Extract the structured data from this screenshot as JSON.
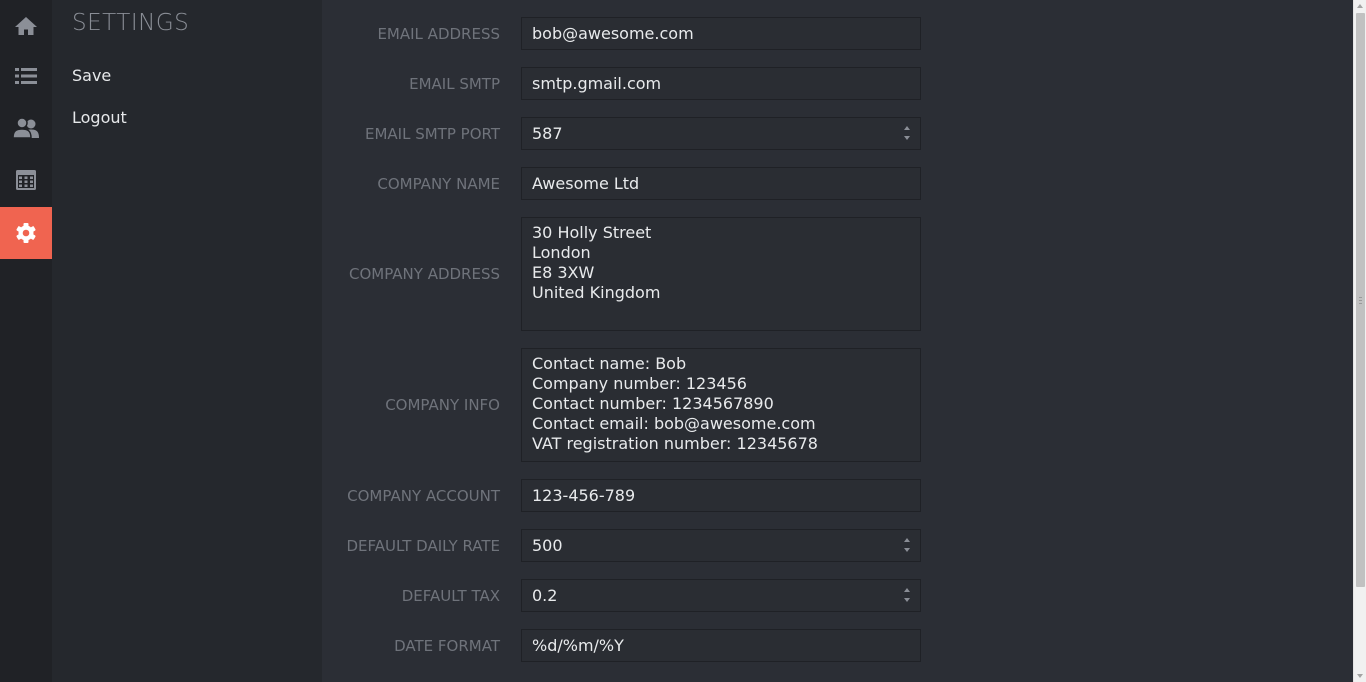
{
  "rail": {
    "items": [
      {
        "icon": "home-icon",
        "active": false
      },
      {
        "icon": "list-icon",
        "active": false
      },
      {
        "icon": "users-icon",
        "active": false
      },
      {
        "icon": "calendar-icon",
        "active": false
      },
      {
        "icon": "gear-icon",
        "active": true
      }
    ],
    "active_color": "#f06450"
  },
  "sidebar": {
    "title": "SETTINGS",
    "links": [
      "Save",
      "Logout"
    ]
  },
  "form": {
    "email_address": {
      "label": "EMAIL ADDRESS",
      "value": "bob@awesome.com"
    },
    "email_smtp": {
      "label": "EMAIL SMTP",
      "value": "smtp.gmail.com"
    },
    "email_smtp_port": {
      "label": "EMAIL SMTP PORT",
      "value": "587"
    },
    "company_name": {
      "label": "COMPANY NAME",
      "value": "Awesome Ltd"
    },
    "company_address": {
      "label": "COMPANY ADDRESS",
      "value": "30 Holly Street\nLondon\nE8 3XW\nUnited Kingdom"
    },
    "company_info": {
      "label": "COMPANY INFO",
      "value": "Contact name: Bob\nCompany number: 123456\nContact number: 1234567890\nContact email: bob@awesome.com\nVAT registration number: 12345678"
    },
    "company_account": {
      "label": "COMPANY ACCOUNT",
      "value": "123-456-789"
    },
    "default_daily_rate": {
      "label": "DEFAULT DAILY RATE",
      "value": "500"
    },
    "default_tax": {
      "label": "DEFAULT TAX",
      "value": "0.2"
    },
    "date_format": {
      "label": "DATE FORMAT",
      "value": "%d/%m/%Y"
    }
  }
}
